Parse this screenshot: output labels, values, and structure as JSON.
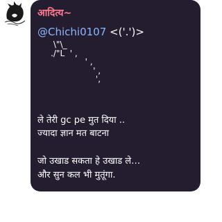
{
  "message": {
    "sender_name": "आदित्य~",
    "mention": "@Chichi0107",
    "emoticon": "<('.')>",
    "ascii_art": [
      "      \\\"\\_",
      "     ./\"L  ' ,",
      "                  ' ,",
      "                     ' ,",
      "                      ',"
    ],
    "lines": [
      "ले तेरी gc pe  मुत  दिया ..",
      "ज्यादा ज्ञान मत बाटना",
      "  जो  उखाड सकता  हे  उखाड ले…",
      "और सुन कल भी  मुतूंगा."
    ]
  },
  "colors": {
    "bubble": "#241d30",
    "sender_name": "#ff7a8e",
    "mention": "#8ab9ff",
    "text": "#ffffff"
  },
  "icons": {
    "avatar": "sketch-character-avatar"
  }
}
